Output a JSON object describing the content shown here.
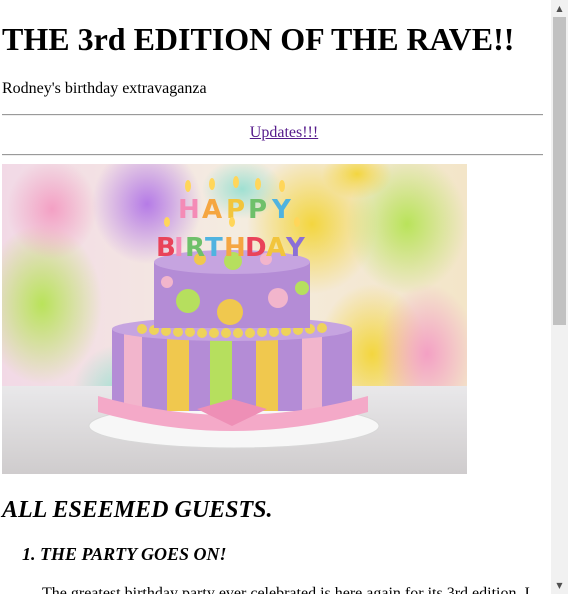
{
  "header": {
    "title": "THE 3rd EDITION OF THE RAVE!!",
    "subtitle": "Rodney's birthday extravaganza"
  },
  "nav": {
    "updates_link": "Updates!!!"
  },
  "hero": {
    "alt": "Happy Birthday cake",
    "candle_letters_top": "HAPPY",
    "candle_letters_bottom": "BIRTHDAY"
  },
  "main": {
    "section_heading": "ALL ESEEMED GUESTS.",
    "list_items": [
      "THE PARTY GOES ON!"
    ],
    "body_text": "The greatest birthday party ever celebrated is here again for its 3rd edition. I"
  },
  "scrollbar": {
    "up_icon": "triangle-up-icon",
    "down_icon": "triangle-down-icon"
  }
}
